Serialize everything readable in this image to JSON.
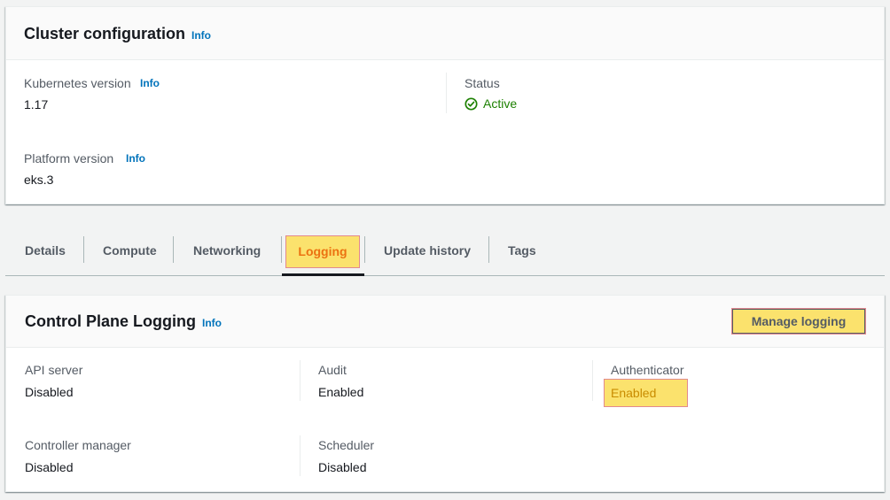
{
  "cluster_config": {
    "title": "Cluster configuration",
    "info": "Info",
    "kubernetes_version": {
      "label": "Kubernetes version",
      "info": "Info",
      "value": "1.17"
    },
    "status": {
      "label": "Status",
      "value": "Active"
    },
    "platform_version": {
      "label": "Platform version",
      "info": "Info",
      "value": "eks.3"
    }
  },
  "tabs": [
    {
      "label": "Details"
    },
    {
      "label": "Compute"
    },
    {
      "label": "Networking"
    },
    {
      "label": "Logging"
    },
    {
      "label": "Update history"
    },
    {
      "label": "Tags"
    }
  ],
  "active_tab": "Logging",
  "logging": {
    "title": "Control Plane Logging",
    "info": "Info",
    "manage_button": "Manage logging",
    "items": [
      {
        "label": "API server",
        "value": "Disabled"
      },
      {
        "label": "Audit",
        "value": "Enabled"
      },
      {
        "label": "Authenticator",
        "value": "Enabled"
      },
      {
        "label": "Controller manager",
        "value": "Disabled"
      },
      {
        "label": "Scheduler",
        "value": "Disabled"
      }
    ]
  },
  "colors": {
    "link": "#0073bb",
    "status_active": "#1d8102",
    "highlight": "#fbe26d",
    "highlight_border": "#e2898e",
    "active_tab_text": "#ec7211"
  },
  "icons": {
    "status": "check-circle-icon"
  }
}
